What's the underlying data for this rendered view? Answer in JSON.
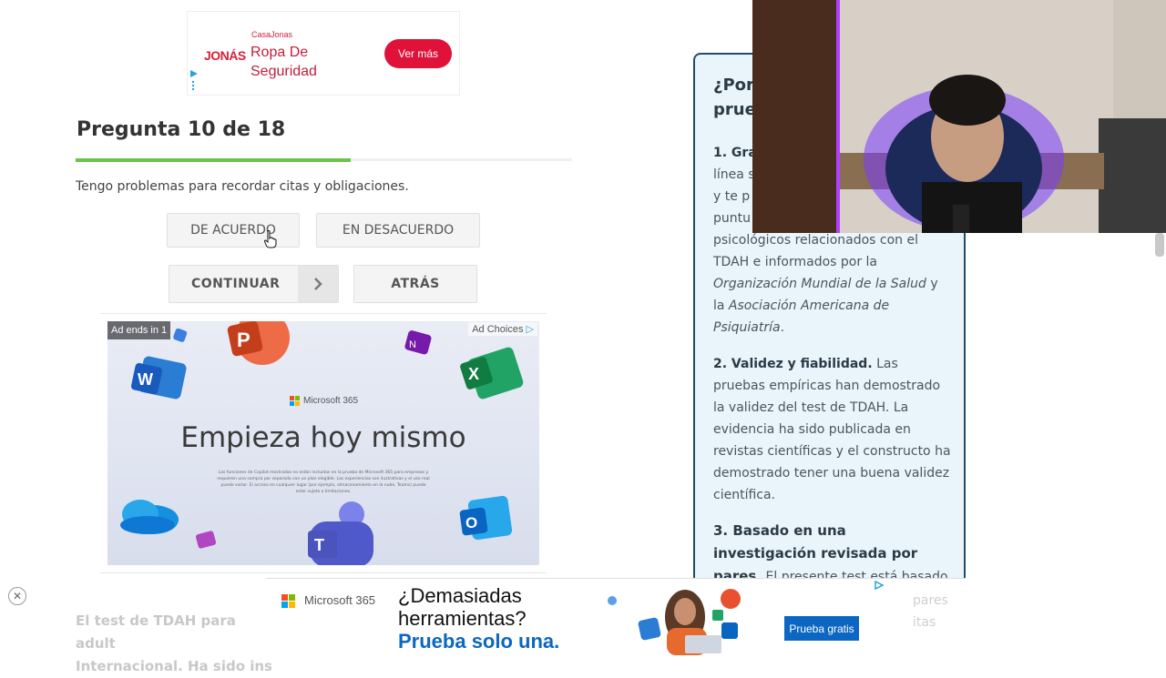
{
  "top_ad": {
    "brand_small": "CasaJonas",
    "brand_logo": "JONÁS",
    "headline": "Ropa De Seguridad",
    "cta": "Ver más"
  },
  "quiz": {
    "title": "Pregunta 10 de 18",
    "progress_fraction": 0.555,
    "question": "Tengo problemas para recordar citas y obligaciones.",
    "agree_label": "DE ACUERDO",
    "disagree_label": "EN DESACUERDO",
    "continue_label": "CONTINUAR",
    "back_label": "ATRÁS"
  },
  "ms_ad": {
    "ends_label": "Ad ends in 1",
    "choices_label": "Ad Choices",
    "brand": "Microsoft 365",
    "headline": "Empieza hoy mismo",
    "fine_print": "Las funciones de Copilot mostradas no están incluidas en la prueba de Microsoft 365 para empresas y requieren una compra por separado con un plan elegible. Las experiencias son ilustrativas y el uso real puede variar. El acceso en cualquier lugar (por ejemplo, almacenamiento en la nube, Teams) puede estar sujeto a limitaciones."
  },
  "info_card": {
    "heading": "¿Por qué confiar en esta prueba?",
    "p1_bold": "1. Gra",
    "p1_lines": [
      "línea s",
      "y te p",
      "puntu"
    ],
    "p1_rest_a": "psicológicos relacionados con el TDAH e informados por la ",
    "p1_italic1": "Organización Mundial de la Salud",
    "p1_rest_b": " y la ",
    "p1_italic2": "Asociación Americana de Psiquiatría",
    "p1_end": ".",
    "p2_bold": "2. Validez y fiabilidad.",
    "p2_text": " Las pruebas empíricas han demostrado la validez del test de TDAH. La evidencia ha sido publicada en revistas científicas y el constructo ha demostrado tener una buena validez científica.",
    "p3_bold": "3. Basado en una investigación revisada por pares.",
    "p3_text": " El presente test está basado en una"
  },
  "bottom_ad": {
    "brand": "Microsoft 365",
    "line1": "¿Demasiadas",
    "line2": "herramientas?",
    "line3": "Prueba solo una.",
    "cta": "Prueba gratis"
  },
  "footer": {
    "text_line1": "El test de TDAH para adult",
    "text_line2": "Internacional. Ha sido ins",
    "faded_right_1": "pares",
    "faded_right_2": "itas"
  },
  "colors": {
    "progress": "#6cc24a",
    "card_border": "#1e4e6e",
    "card_bg": "#e9f4fb",
    "ad_red": "#e0123a",
    "ms_blue": "#0b67c2"
  }
}
